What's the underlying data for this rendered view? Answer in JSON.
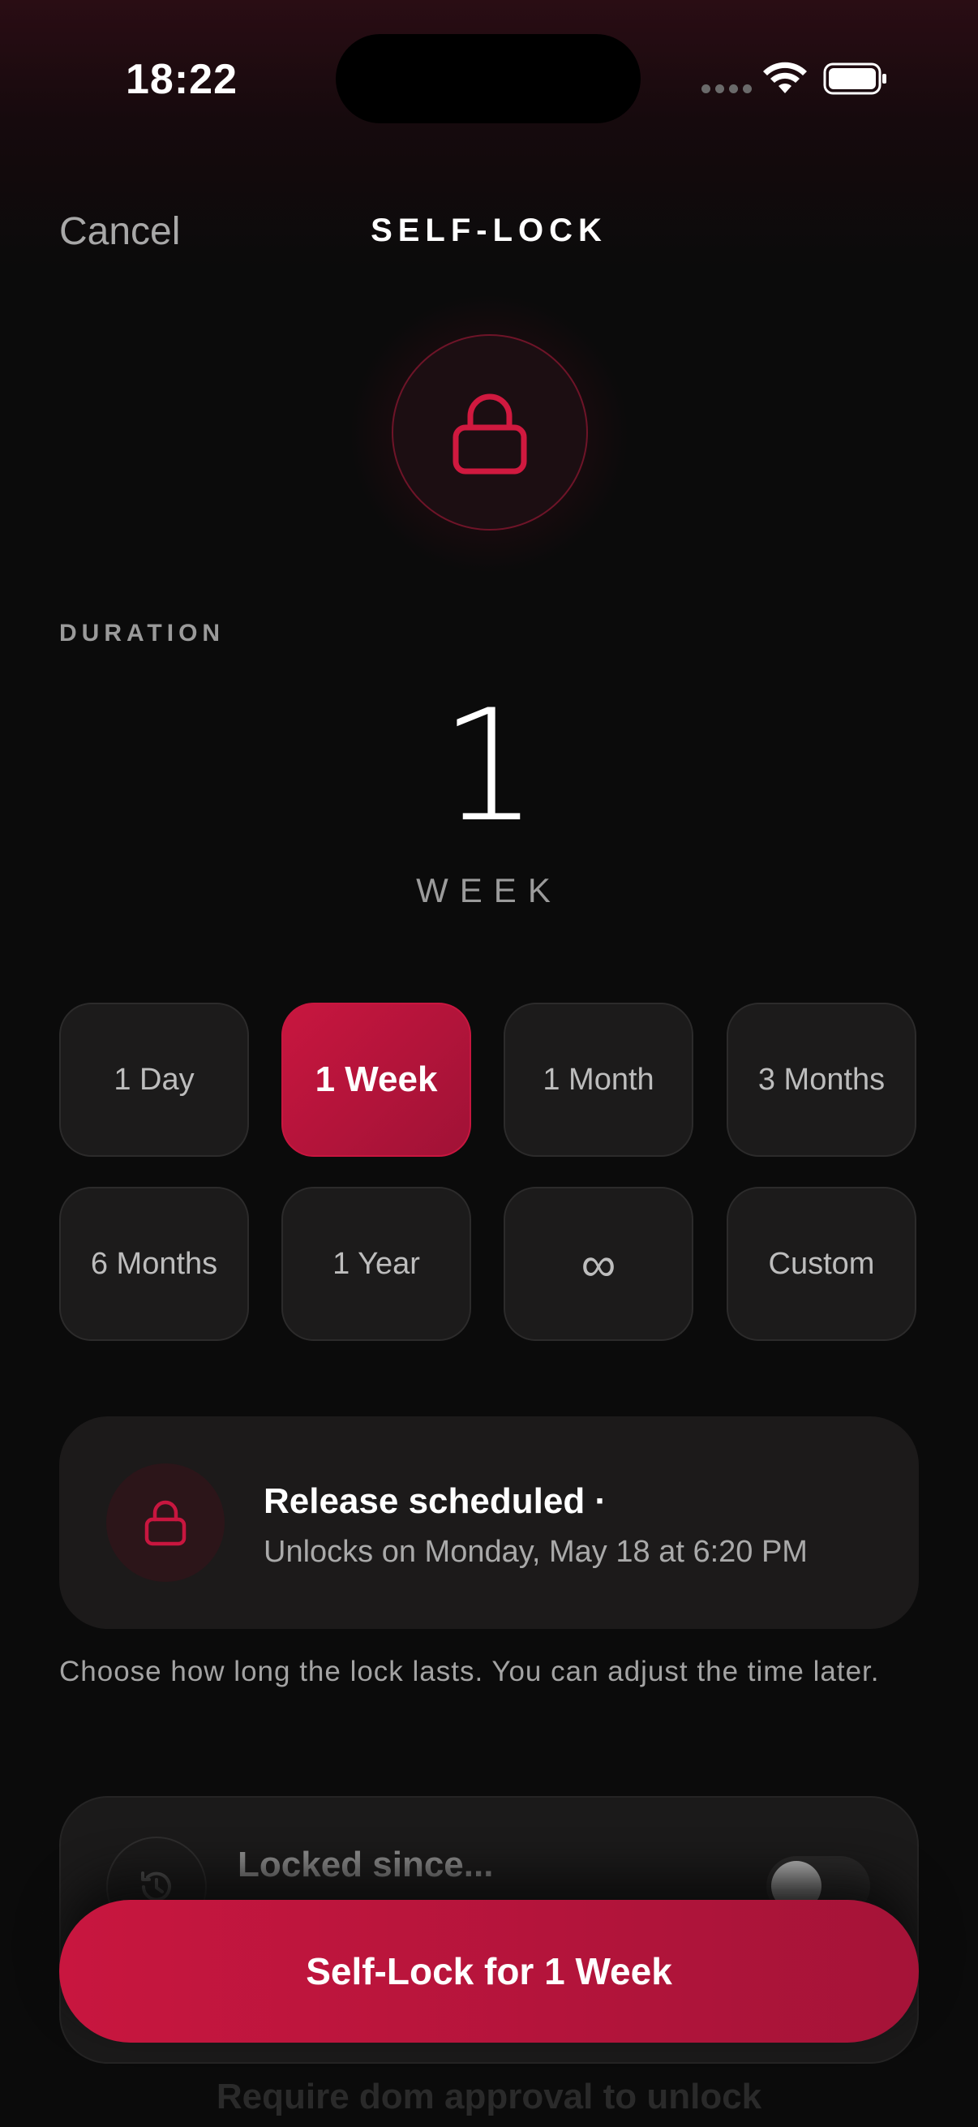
{
  "status_bar": {
    "time": "18:22"
  },
  "nav": {
    "cancel_label": "Cancel",
    "title": "SELF-LOCK"
  },
  "duration": {
    "section_label": "DURATION",
    "value": "1",
    "unit": "WEEK",
    "options": [
      "1 Day",
      "1 Week",
      "1 Month",
      "3 Months",
      "6 Months",
      "1 Year",
      "∞",
      "Custom"
    ],
    "selected": "1 Week"
  },
  "release": {
    "title": "Release scheduled ·",
    "subtitle": "Unlocks on Monday, May 18 at 6:20 PM"
  },
  "helper_text": "Choose how long the lock lasts. You can adjust the time later.",
  "locked_since": {
    "title": "Locked since...",
    "toggle_on": false
  },
  "partial_text": "Require dom approval to unlock",
  "cta_label": "Self-Lock for 1 Week",
  "colors": {
    "accent": "#c8163f",
    "background": "#0b0b0b",
    "card": "#1c1b1b"
  }
}
